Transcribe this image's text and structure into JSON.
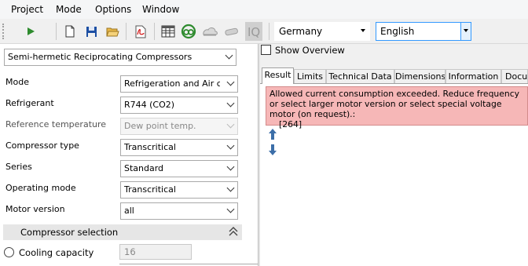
{
  "menu": [
    "Project",
    "Mode",
    "Options",
    "Window"
  ],
  "toolbar": {
    "icons": [
      "run-icon",
      "new-document-icon",
      "save-icon",
      "open-folder-icon",
      "pdf-icon",
      "table-icon",
      "compressor-cycle-icon",
      "cloud-icon",
      "tube-icon",
      "iq-icon"
    ],
    "country_value": "Germany",
    "language_value": "English"
  },
  "left": {
    "product_group": "Semi-hermetic Reciprocating Compressors",
    "fields": [
      {
        "label": "Mode",
        "value": "Refrigeration and Air conditioning",
        "disabled": false
      },
      {
        "label": "Refrigerant",
        "value": "R744 (CO2)",
        "disabled": false
      },
      {
        "label": "Reference temperature",
        "value": "Dew point temp.",
        "disabled": true
      },
      {
        "label": "Compressor type",
        "value": "Transcritical",
        "disabled": false
      },
      {
        "label": "Series",
        "value": "Standard",
        "disabled": false
      },
      {
        "label": "Operating mode",
        "value": "Transcritical",
        "disabled": false
      },
      {
        "label": "Motor version",
        "value": "all",
        "disabled": false
      }
    ],
    "section_title": "Compressor selection",
    "cooling_capacity_label": "Cooling capacity",
    "cooling_capacity_value": "16"
  },
  "right": {
    "show_overview_label": "Show Overview",
    "tabs": [
      "Result",
      "Limits",
      "Technical Data",
      "Dimensions",
      "Information",
      "Docun"
    ],
    "active_tab": "Result",
    "message": "Allowed current consumption exceeded. Reduce frequency or select larger motor version or select special voltage motor (on request).:",
    "message_code": "[264]"
  },
  "colors": {
    "error_bg": "#f6b7b7",
    "error_border": "#d38b8b",
    "arrow_blue": "#3c6ea8",
    "language_focus": "#3399ff"
  }
}
